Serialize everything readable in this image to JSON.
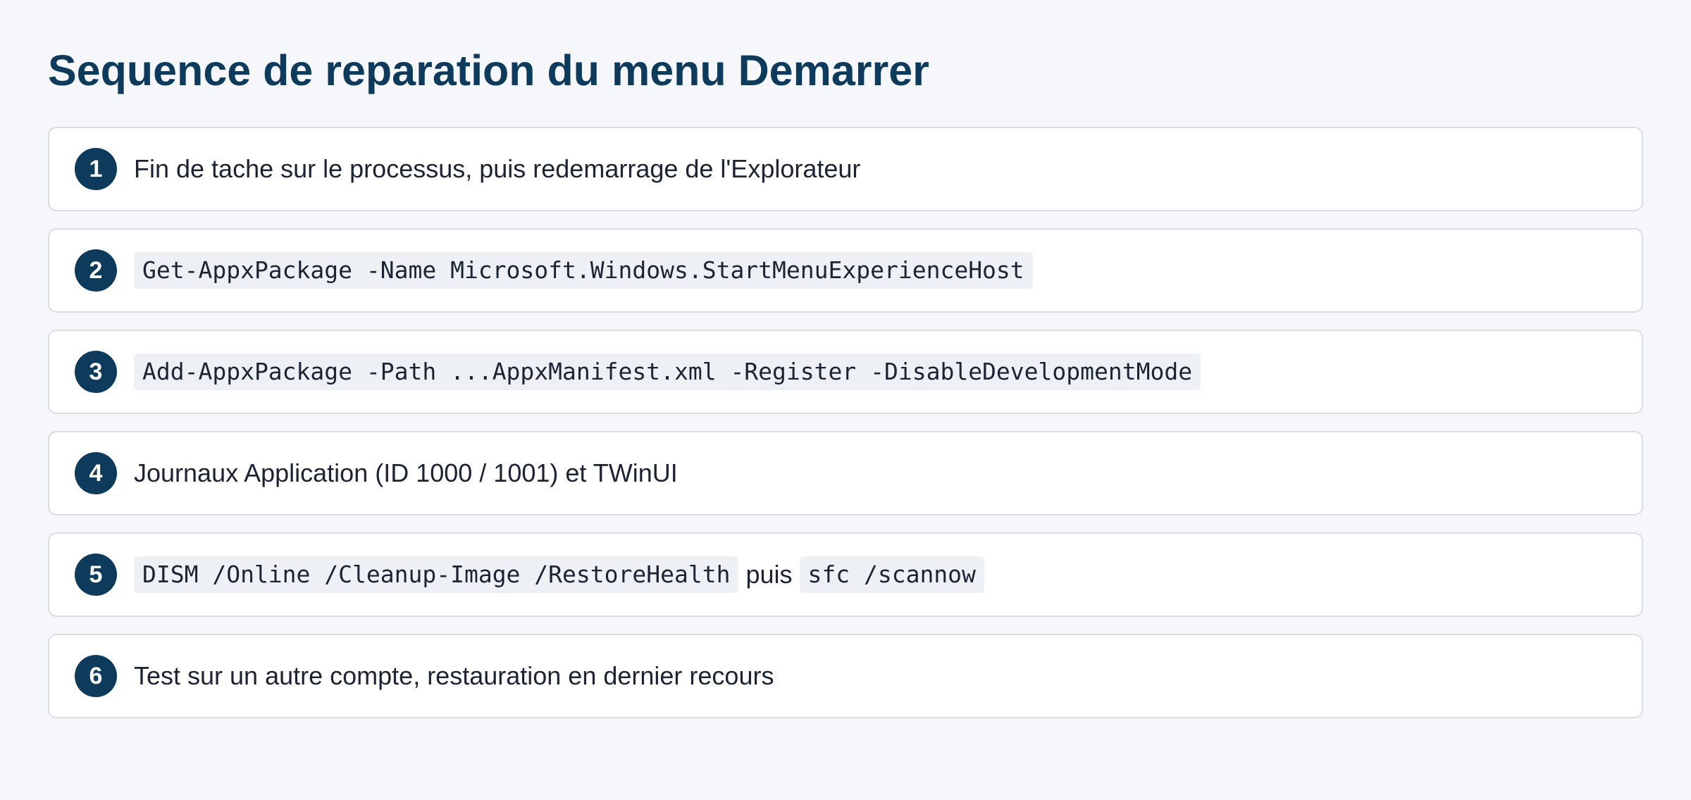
{
  "title": "Sequence de reparation du menu Demarrer",
  "colors": {
    "background": "#f5f7fa",
    "accent": "#0e3a5c",
    "card_border": "#d6dde6",
    "code_bg": "#edf1f5",
    "text": "#1c2433"
  },
  "steps": [
    {
      "number": "1",
      "text": "Fin de tache sur le processus, puis redemarrage de l'Explorateur"
    },
    {
      "number": "2",
      "code": "Get-AppxPackage -Name Microsoft.Windows.StartMenuExperienceHost"
    },
    {
      "number": "3",
      "code": "Add-AppxPackage -Path ...AppxManifest.xml -Register -DisableDevelopmentMode"
    },
    {
      "number": "4",
      "text": "Journaux Application (ID 1000 / 1001) et TWinUI"
    },
    {
      "number": "5",
      "code": "DISM /Online /Cleanup-Image /RestoreHealth",
      "joiner": "puis",
      "code2": "sfc /scannow"
    },
    {
      "number": "6",
      "text": "Test sur un autre compte, restauration en dernier recours"
    }
  ]
}
